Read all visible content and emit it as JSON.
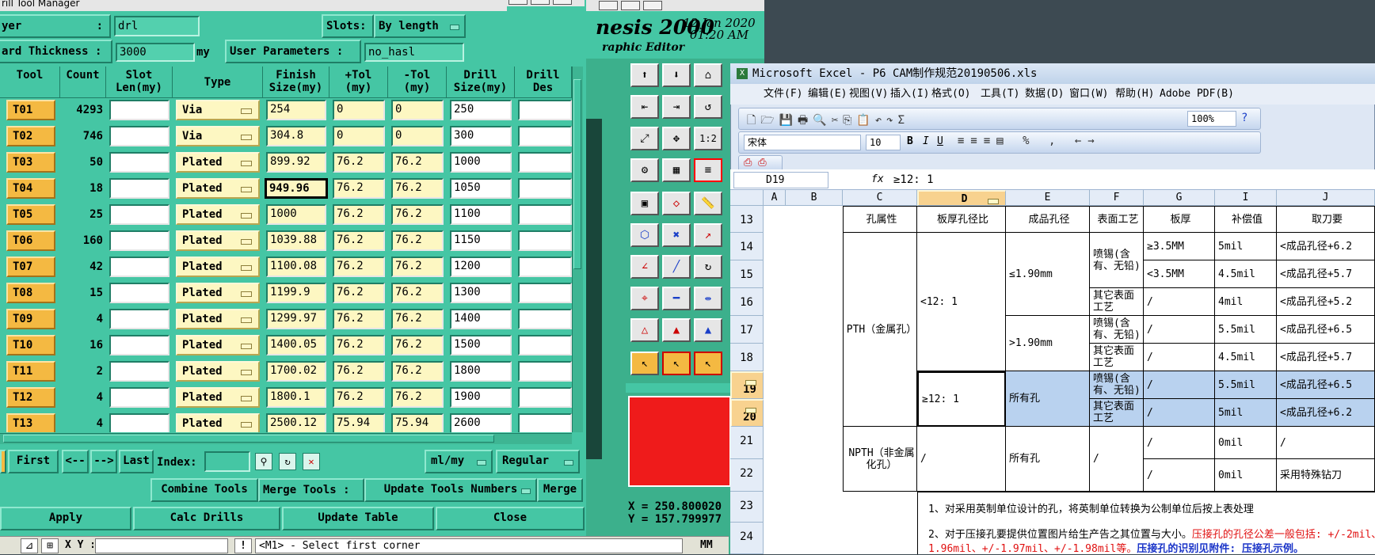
{
  "drill": {
    "title": "rill Tool Manager",
    "layer_label": "yer",
    "layer_colon": ":",
    "layer_value": "drl",
    "slots_label": "Slots:",
    "slots_value": "By length",
    "thickness_label": "ard Thickness :",
    "thickness_value": "3000",
    "thickness_unit": "my",
    "user_params_label": "User Parameters :",
    "user_params_value": "no_hasl",
    "headers": [
      "Tool",
      "Count",
      "Slot\nLen(my)",
      "Type",
      "Finish\nSize(my)",
      "+Tol\n(my)",
      "-Tol\n(my)",
      "Drill\nSize(my)",
      "Drill\nDes"
    ],
    "rows": [
      {
        "tool": "T01",
        "count": "4293",
        "type": "Via",
        "finish": "254",
        "ptol": "0",
        "mtol": "0",
        "drill": "250"
      },
      {
        "tool": "T02",
        "count": "746",
        "type": "Via",
        "finish": "304.8",
        "ptol": "0",
        "mtol": "0",
        "drill": "300"
      },
      {
        "tool": "T03",
        "count": "50",
        "type": "Plated",
        "finish": "899.92",
        "ptol": "76.2",
        "mtol": "76.2",
        "drill": "1000"
      },
      {
        "tool": "T04",
        "count": "18",
        "type": "Plated",
        "finish": "949.96",
        "ptol": "76.2",
        "mtol": "76.2",
        "drill": "1050"
      },
      {
        "tool": "T05",
        "count": "25",
        "type": "Plated",
        "finish": "1000",
        "ptol": "76.2",
        "mtol": "76.2",
        "drill": "1100"
      },
      {
        "tool": "T06",
        "count": "160",
        "type": "Plated",
        "finish": "1039.88",
        "ptol": "76.2",
        "mtol": "76.2",
        "drill": "1150"
      },
      {
        "tool": "T07",
        "count": "42",
        "type": "Plated",
        "finish": "1100.08",
        "ptol": "76.2",
        "mtol": "76.2",
        "drill": "1200"
      },
      {
        "tool": "T08",
        "count": "15",
        "type": "Plated",
        "finish": "1199.9",
        "ptol": "76.2",
        "mtol": "76.2",
        "drill": "1300"
      },
      {
        "tool": "T09",
        "count": "4",
        "type": "Plated",
        "finish": "1299.97",
        "ptol": "76.2",
        "mtol": "76.2",
        "drill": "1400"
      },
      {
        "tool": "T10",
        "count": "16",
        "type": "Plated",
        "finish": "1400.05",
        "ptol": "76.2",
        "mtol": "76.2",
        "drill": "1500"
      },
      {
        "tool": "T11",
        "count": "2",
        "type": "Plated",
        "finish": "1700.02",
        "ptol": "76.2",
        "mtol": "76.2",
        "drill": "1800"
      },
      {
        "tool": "T12",
        "count": "4",
        "type": "Plated",
        "finish": "1800.1",
        "ptol": "76.2",
        "mtol": "76.2",
        "drill": "1900"
      },
      {
        "tool": "T13",
        "count": "4",
        "type": "Plated",
        "finish": "2500.12",
        "ptol": "75.94",
        "mtol": "75.94",
        "drill": "2600"
      }
    ],
    "nav": {
      "first": "First",
      "prev": "<--",
      "next": "-->",
      "last": "Last",
      "index_label": "Index:",
      "units": "ml/my",
      "mode": "Regular"
    },
    "combine": "Combine Tools",
    "merge_label": "Merge Tools :",
    "merge_select": "Update Tools Numbers",
    "merge": "Merge",
    "apply": "Apply",
    "calc": "Calc Drills",
    "update": "Update Table",
    "close": "Close"
  },
  "status": {
    "xy_label": "X Y :",
    "message": "<M1> - Select first corner",
    "mm": "MM"
  },
  "genesis": {
    "name": "nesis 2000",
    "date": "12 Jan 2020",
    "time": "01:20 AM",
    "subtitle": "raphic Editor",
    "coord_x": "X = 250.800020",
    "coord_y": "Y = 157.799977"
  },
  "excel": {
    "title": "Microsoft Excel - P6 CAM制作规范20190506.xls",
    "menus": [
      "文件(F)",
      "编辑(E)",
      "视图(V)",
      "插入(I)",
      "格式(O)",
      "工具(T)",
      "数据(D)",
      "窗口(W)",
      "帮助(H)",
      "Adobe PDF(B)"
    ],
    "zoom": "100%",
    "font": "宋体",
    "font_size": "10",
    "namebox": "D19",
    "fx": "fx",
    "formula": "≥12: 1",
    "cols": [
      "A",
      "B",
      "C",
      "D",
      "E",
      "F",
      "G",
      "I",
      "J"
    ],
    "rows": [
      "13",
      "14",
      "15",
      "16",
      "17",
      "18",
      "19",
      "20",
      "21",
      "22",
      "23",
      "24"
    ],
    "h_c": "孔属性",
    "h_d": "板厚孔径比",
    "h_e": "成品孔径",
    "h_f": "表面工艺",
    "h_g": "板厚",
    "h_i": "补偿值",
    "h_j": "取刀要",
    "pth": "PTH（金属孔）",
    "lt12": "<12: 1",
    "le190": "≤1.90mm",
    "gt190": ">1.90mm",
    "penxi": "喷锡(含有、无铅)",
    "other": "其它表面工艺",
    "ge35": "≥3.5MM",
    "lt35": "<3.5MM",
    "slash": "/",
    "m45": "4.5mil",
    "m4": "4mil",
    "m55": "5.5mil",
    "m5": "5mil",
    "m0": "0mil",
    "j14": "<成品孔径+6.2",
    "j15": "<成品孔径+5.7",
    "j16": "<成品孔径+5.2",
    "j17": "<成品孔径+6.5",
    "j18": "<成品孔径+5.7",
    "j19": "<成品孔径+6.5",
    "j20": "<成品孔径+6.2",
    "ge12": "≥12: 1",
    "all": "所有孔",
    "npth": "NPTH（非金属化孔）",
    "special": "采用特殊钻刀",
    "note23": "1、对采用英制单位设计的孔，将英制单位转换为公制单位后按上表处理",
    "note24a": "2、对于压接孔要提供位置图片给生产告之其位置与大小。",
    "note24b": "压接孔的孔径公差一般包括: +/-2mil、",
    "note24c": "1.96mil、+/-1.97mil、+/-1.98mil等。",
    "note24d": "压接孔的识别见附件: 压接孔示例。"
  },
  "colors": {
    "motif_bg": "#45c6a4",
    "tool_orange": "#f4b942",
    "cell_yellow": "#fdf7c2",
    "red_panel": "#ef1b1b",
    "excel_sel": "#b9d2ef"
  }
}
